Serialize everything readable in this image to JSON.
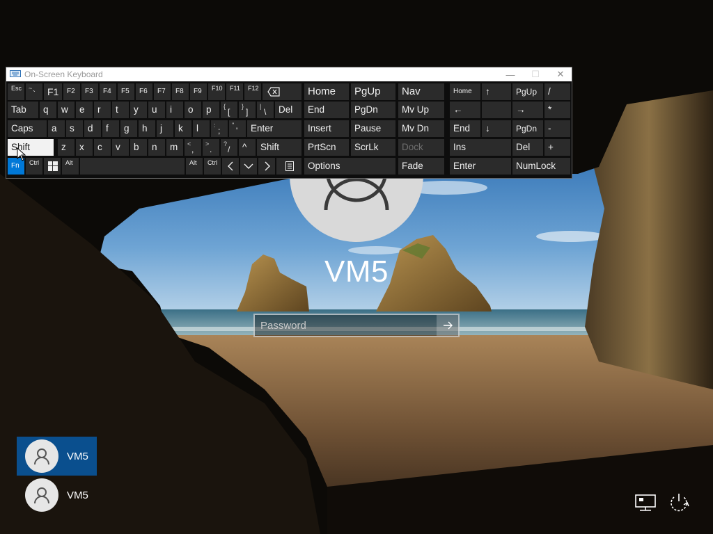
{
  "osk": {
    "title": "On-Screen Keyboard",
    "controls": {
      "minimize": "—",
      "maximize": "☐",
      "close": "✕"
    },
    "row1": {
      "esc": "Esc",
      "tilde_top": "~",
      "tilde_bottom": "`",
      "f1": "F1",
      "f2": "F2",
      "f3": "F3",
      "f4": "F4",
      "f5": "F5",
      "f6": "F6",
      "f7": "F7",
      "f8": "F8",
      "f9": "F9",
      "f10": "F10",
      "f11": "F11",
      "f12": "F12"
    },
    "row2": {
      "tab": "Tab",
      "q": "q",
      "w": "w",
      "e": "e",
      "r": "r",
      "t": "t",
      "y": "y",
      "u": "u",
      "i": "i",
      "o": "o",
      "p": "p",
      "lbrace": "{",
      "lbracket": "[",
      "rbrace": "}",
      "rbracket": "]",
      "pipe": "|",
      "backslash": "\\",
      "del": "Del"
    },
    "row3": {
      "caps": "Caps",
      "a": "a",
      "s": "s",
      "d": "d",
      "f": "f",
      "g": "g",
      "h": "h",
      "j": "j",
      "k": "k",
      "l": "l",
      "colon": ":",
      "semicolon": ";",
      "quote_top": "\"",
      "quote_bottom": "'",
      "enter": "Enter"
    },
    "row4": {
      "shift_left": "Shift",
      "z": "z",
      "x": "x",
      "c": "c",
      "v": "v",
      "b": "b",
      "n": "n",
      "m": "m",
      "lt": "<",
      "comma": ",",
      "gt": ">",
      "period": ".",
      "question": "?",
      "slash": "/",
      "up": "^",
      "shift_right": "Shift"
    },
    "row5": {
      "fn": "Fn",
      "ctrl_left": "Ctrl",
      "alt_left": "Alt",
      "alt_right": "Alt",
      "ctrl_right": "Ctrl"
    },
    "nav": {
      "home": "Home",
      "pgup": "PgUp",
      "end": "End",
      "pgdn": "PgDn",
      "insert": "Insert",
      "pause": "Pause",
      "prtscn": "PrtScn",
      "scrlk": "ScrLk",
      "options": "Options",
      "nav": "Nav",
      "mvup": "Mv Up",
      "mvdn": "Mv Dn",
      "dock": "Dock",
      "fade": "Fade"
    },
    "numpad": {
      "home": "Home",
      "up": "↑",
      "pgup": "PgUp",
      "divide": "/",
      "left": "←",
      "right": "→",
      "multiply": "*",
      "end": "End",
      "down": "↓",
      "pgdn": "PgDn",
      "minus": "-",
      "ins": "Ins",
      "del": "Del",
      "plus": "+",
      "enter": "Enter",
      "numlock": "NumLock"
    }
  },
  "login": {
    "username": "VM5",
    "password_placeholder": "Password"
  },
  "users": [
    {
      "name": "VM5",
      "active": true
    },
    {
      "name": "VM5",
      "active": false
    }
  ],
  "icons": {
    "network": "network-icon",
    "power": "ease-of-access-power-icon",
    "submit": "arrow-right-icon",
    "avatar": "user-silhouette-icon"
  },
  "colors": {
    "accent": "#0078d7",
    "active_user_bg": "#0a4f8e",
    "key_bg": "#2b2b2b"
  }
}
